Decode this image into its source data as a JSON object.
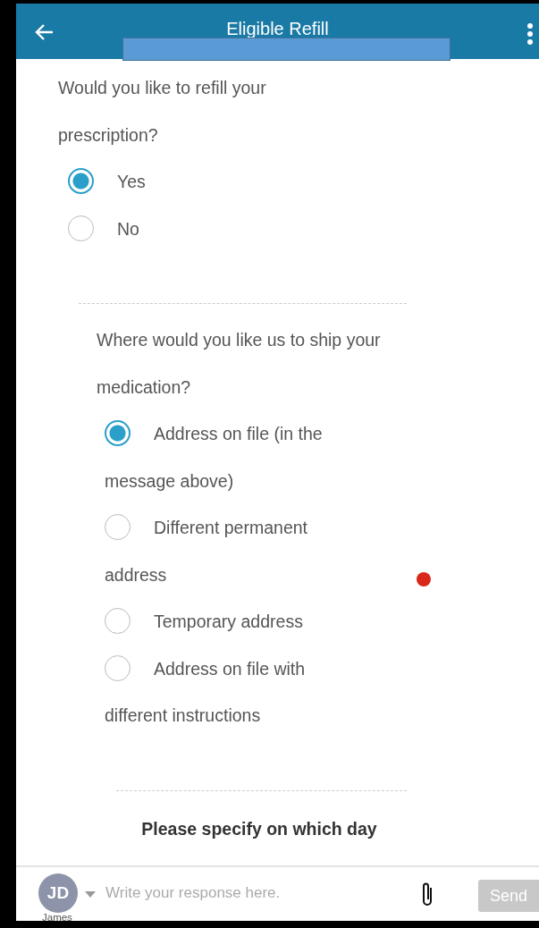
{
  "header": {
    "title": "Eligible Refill"
  },
  "sections": [
    {
      "kind": "radio",
      "prompt": "Would you like to refill your prescription?",
      "options": [
        {
          "label": "Yes",
          "selected": true
        },
        {
          "label": "No",
          "selected": false
        }
      ]
    },
    {
      "kind": "radio",
      "prompt": "Where would you like us to ship your medication?",
      "options": [
        {
          "label": "Address on file (in the message above)",
          "selected": true
        },
        {
          "label": "Different permanent address",
          "selected": false
        },
        {
          "label": "Temporary address",
          "selected": false
        },
        {
          "label": "Address on file with different instructions",
          "selected": false
        }
      ]
    },
    {
      "kind": "heading",
      "prompt": "Please specify on which day"
    }
  ],
  "composer": {
    "initials": "JD",
    "name": "James",
    "placeholder": "Write your response here.",
    "send": {
      "label": "Send",
      "disabled": true
    }
  }
}
